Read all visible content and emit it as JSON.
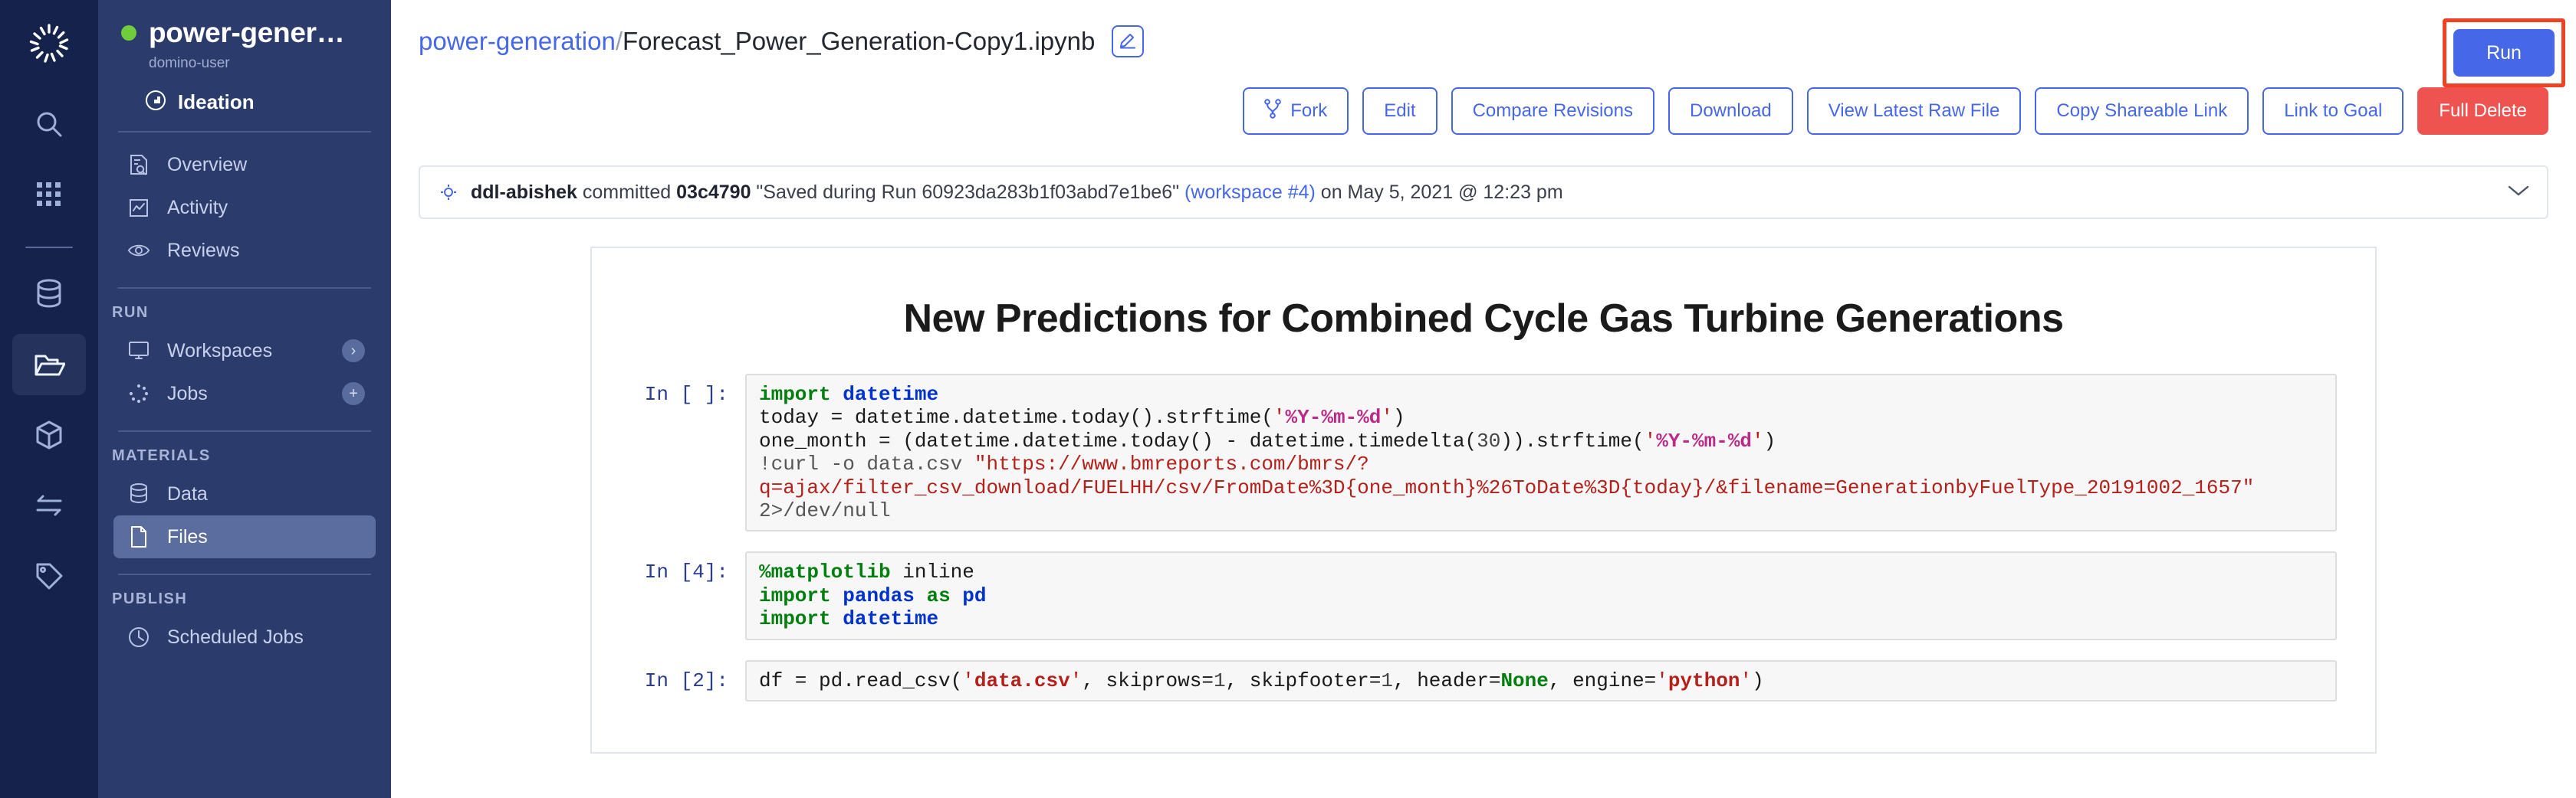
{
  "rail": {
    "logo_icon": "domino-logo-icon",
    "items": [
      {
        "name": "search-icon",
        "label": "Search",
        "active": false
      },
      {
        "name": "apps-grid-icon",
        "label": "Apps",
        "active": false
      },
      {
        "name": "database-icon",
        "label": "Data",
        "active": false
      },
      {
        "name": "folder-open-icon",
        "label": "Projects",
        "active": true
      },
      {
        "name": "cube-icon",
        "label": "Environments",
        "active": false
      },
      {
        "name": "transfer-arrows-icon",
        "label": "Transfers",
        "active": false
      },
      {
        "name": "tag-icon",
        "label": "Tags",
        "active": false
      }
    ]
  },
  "sidebar": {
    "project_name": "power-gener…",
    "project_owner": "domino-user",
    "status_dot_color": "#6fcf3a",
    "stage_label": "Ideation",
    "stage_icon": "stage-ideation-icon",
    "nav_primary": [
      {
        "label": "Overview",
        "icon": "overview-doc-search-icon",
        "active": false
      },
      {
        "label": "Activity",
        "icon": "activity-chart-icon",
        "active": false
      },
      {
        "label": "Reviews",
        "icon": "eye-icon",
        "active": false
      }
    ],
    "sections": [
      {
        "title": "RUN",
        "items": [
          {
            "label": "Workspaces",
            "icon": "monitor-icon",
            "active": false,
            "badge": "›"
          },
          {
            "label": "Jobs",
            "icon": "spinner-dots-icon",
            "active": false,
            "badge": "+"
          }
        ]
      },
      {
        "title": "MATERIALS",
        "items": [
          {
            "label": "Data",
            "icon": "database-icon",
            "active": false,
            "badge": ""
          },
          {
            "label": "Files",
            "icon": "file-icon",
            "active": true,
            "badge": ""
          }
        ]
      },
      {
        "title": "PUBLISH",
        "items": [
          {
            "label": "Scheduled Jobs",
            "icon": "clock-icon",
            "active": false,
            "badge": ""
          }
        ]
      }
    ]
  },
  "header": {
    "breadcrumb_project": "power-generation",
    "breadcrumb_separator": "/",
    "breadcrumb_file": "Forecast_Power_Generation-Copy1.ipynb",
    "edit_name_icon": "pencil-edit-icon",
    "run_label": "Run",
    "highlight_color": "#ef4123",
    "accent_color": "#4668e8"
  },
  "actions": [
    {
      "label": "Fork",
      "icon": "fork-branch-icon",
      "style": "outline"
    },
    {
      "label": "Edit",
      "icon": "",
      "style": "outline"
    },
    {
      "label": "Compare Revisions",
      "icon": "",
      "style": "outline"
    },
    {
      "label": "Download",
      "icon": "",
      "style": "outline"
    },
    {
      "label": "View Latest Raw File",
      "icon": "",
      "style": "outline"
    },
    {
      "label": "Copy Shareable Link",
      "icon": "",
      "style": "outline"
    },
    {
      "label": "Link to Goal",
      "icon": "",
      "style": "outline"
    },
    {
      "label": "Full Delete",
      "icon": "",
      "style": "danger"
    }
  ],
  "commit": {
    "icon": "commit-node-icon",
    "author": "ddl-abishek",
    "verb": "committed",
    "hash": "03c4790",
    "message": "\"Saved during Run 60923da283b1f03abd7e1be6\"",
    "workspace_link": "(workspace #4)",
    "timestamp": "on May 5, 2021 @ 12:23 pm",
    "caret_icon": "chevron-down-icon"
  },
  "notebook": {
    "title": "New Predictions for Combined Cycle Gas Turbine Generations",
    "cells": [
      {
        "prompt": "In [ ]:",
        "code": "import datetime\ntoday = datetime.datetime.today().strftime('%Y-%m-%d')\none_month = (datetime.datetime.today() - datetime.timedelta(30)).strftime('%Y-%m-%d')\n!curl -o data.csv \"https://www.bmreports.com/bmrs/?q=ajax/filter_csv_download/FUELHH/csv/FromDate%3D{one_month}%26ToDate%3D{today}/&filename=GenerationbyFuelType_20191002_1657\" 2>/dev/null"
      },
      {
        "prompt": "In [4]:",
        "code": "%matplotlib inline\nimport pandas as pd\nimport datetime"
      },
      {
        "prompt": "In [2]:",
        "code": "df = pd.read_csv('data.csv', skiprows=1, skipfooter=1, header=None, engine='python')"
      }
    ]
  }
}
